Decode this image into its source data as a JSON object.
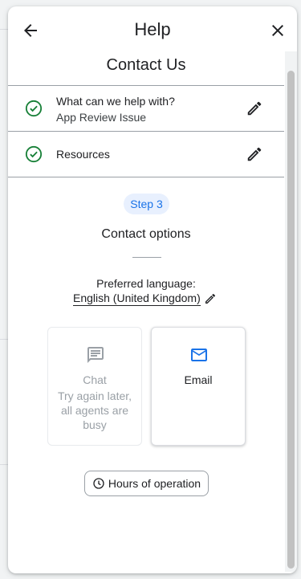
{
  "header": {
    "title": "Help",
    "back_icon": "arrow-back-icon",
    "close_icon": "close-icon"
  },
  "page": {
    "subtitle": "Contact Us"
  },
  "completed_steps": [
    {
      "title": "What can we help with?",
      "value": "App Review Issue",
      "icon": "check-circle-icon",
      "action_icon": "edit-icon"
    },
    {
      "title": "Resources",
      "value": "",
      "icon": "check-circle-icon",
      "action_icon": "edit-icon"
    }
  ],
  "current_step": {
    "badge": "Step 3",
    "title": "Contact options",
    "language_label": "Preferred language:",
    "language_value": "English (United Kingdom)",
    "options": [
      {
        "title": "Chat",
        "note": "Try again later, all agents are busy",
        "icon": "chat-icon",
        "enabled": false
      },
      {
        "title": "Email",
        "note": "",
        "icon": "email-icon",
        "enabled": true
      }
    ],
    "hours_button": "Hours of operation"
  },
  "colors": {
    "accent": "#1a73e8",
    "success": "#188038",
    "badge_bg": "#e8f0fe",
    "disabled_text": "#9aa0a6"
  }
}
